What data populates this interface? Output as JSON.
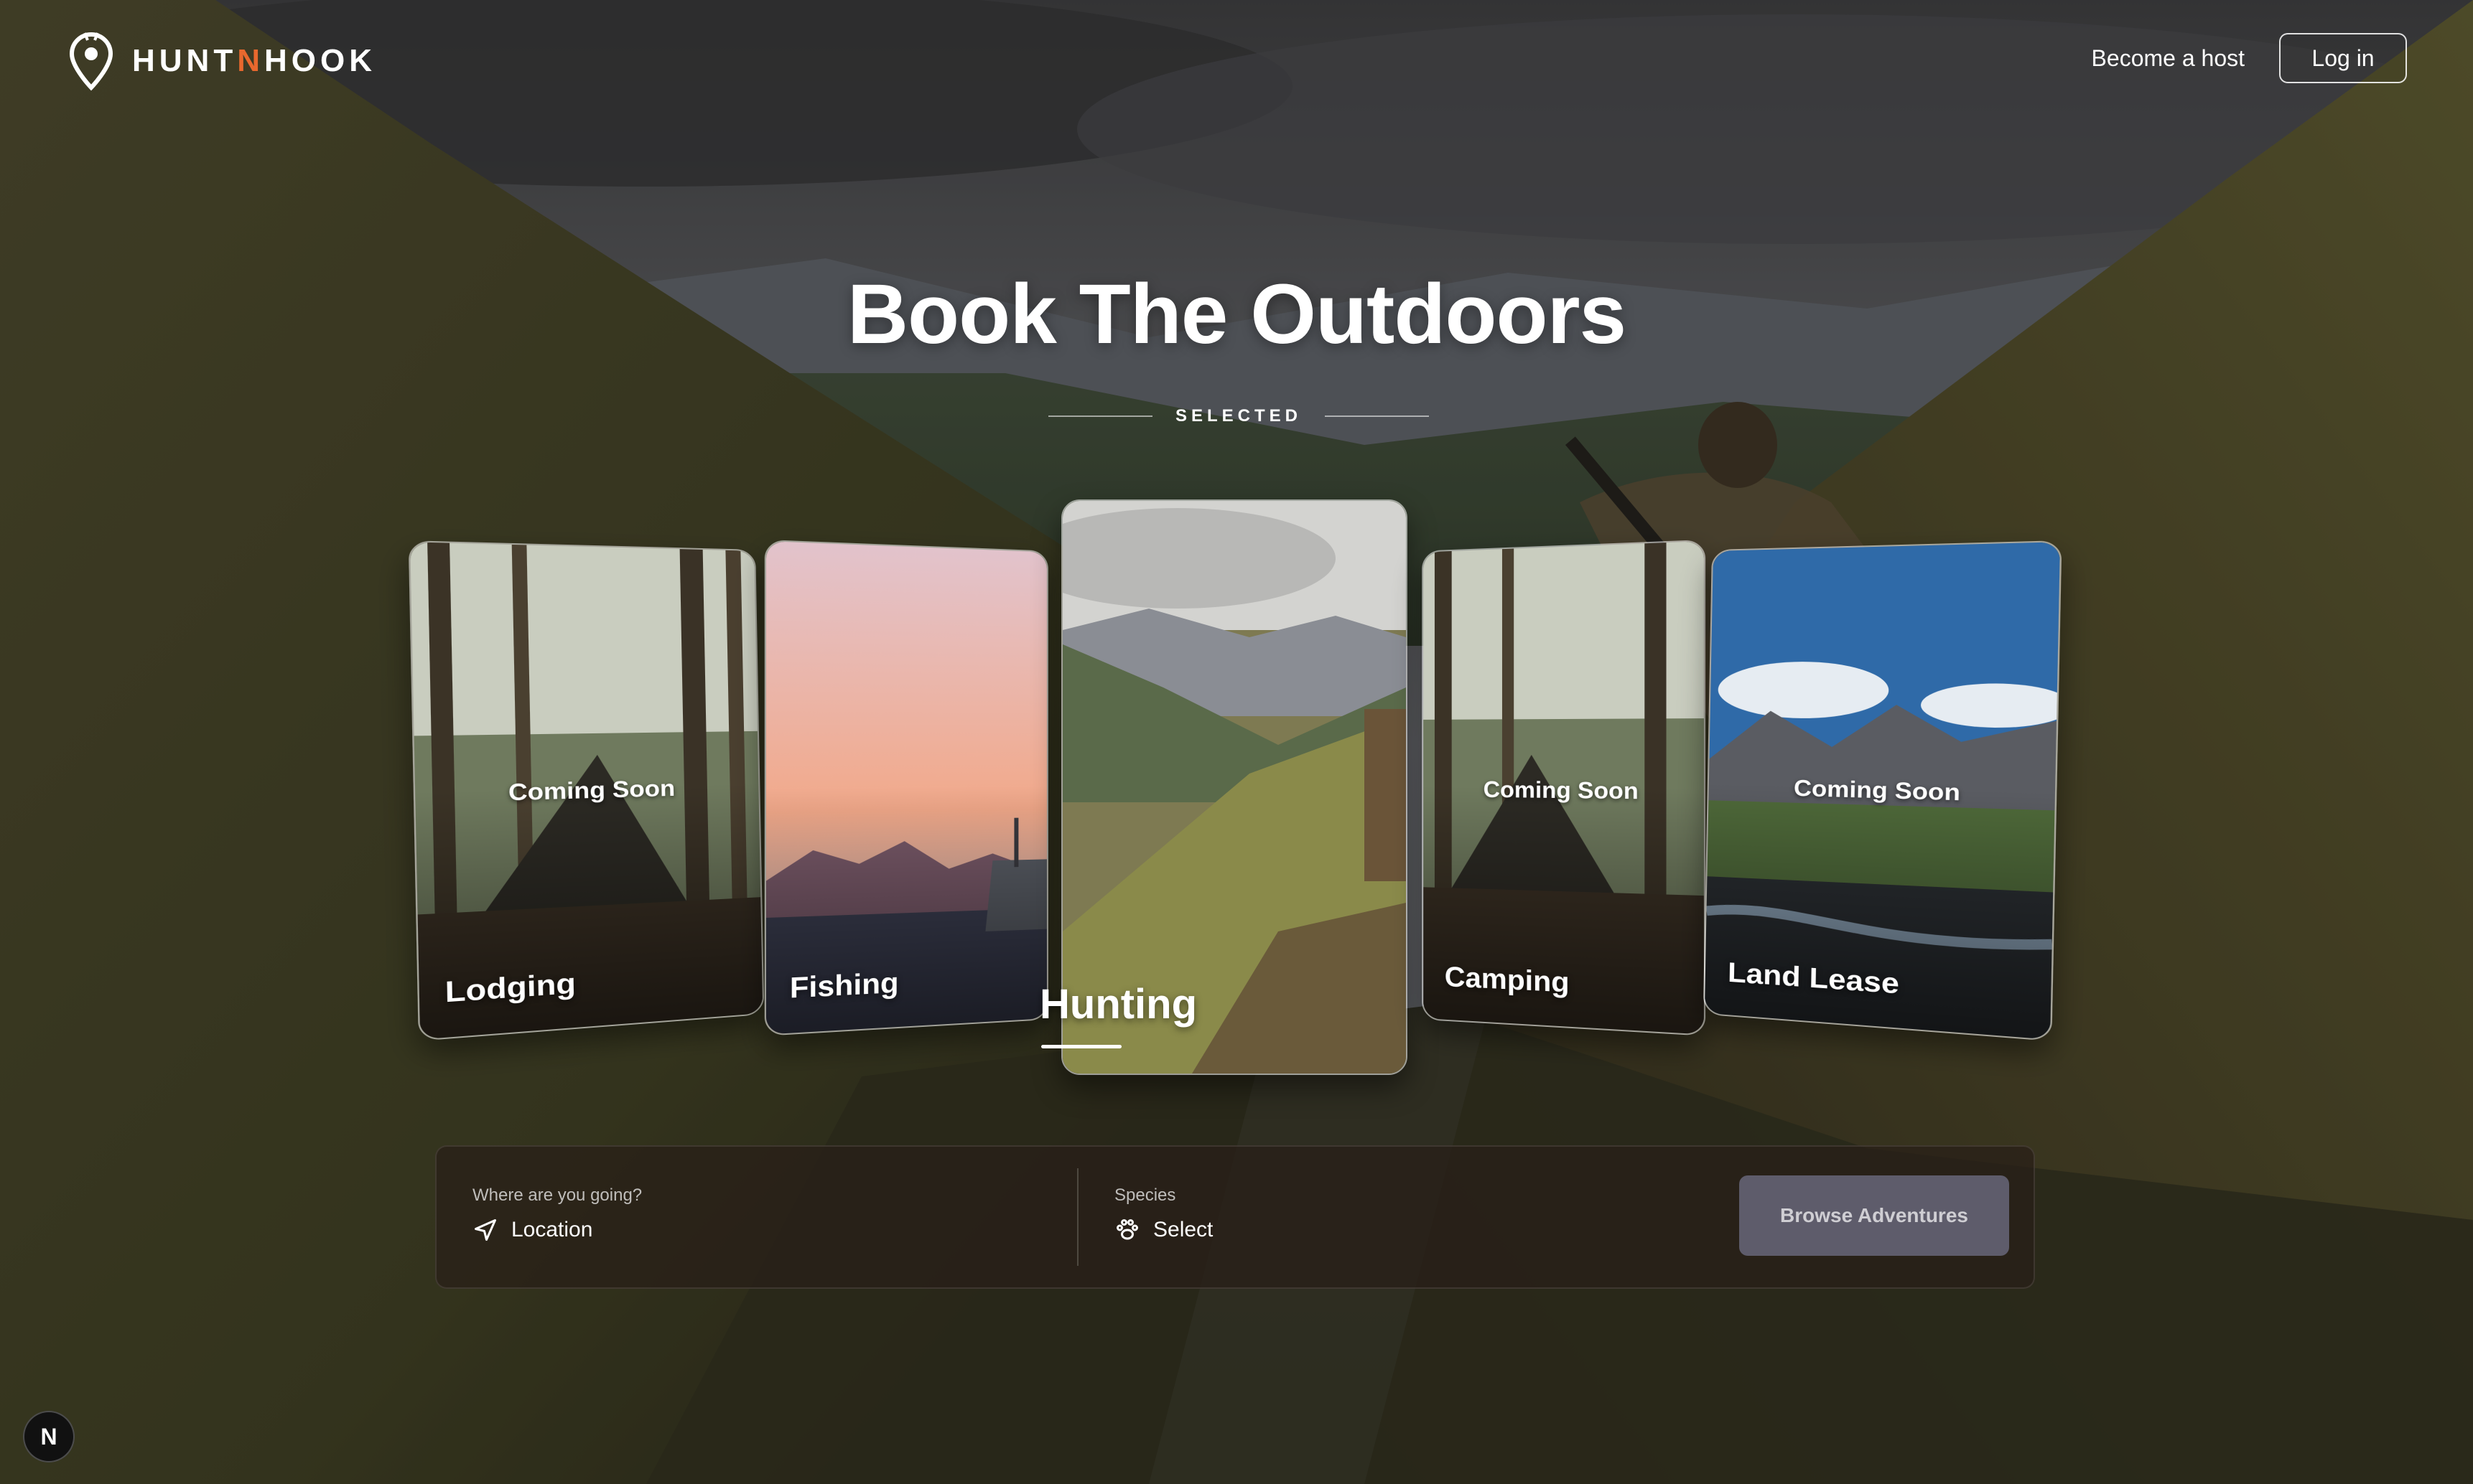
{
  "brand": {
    "name_part1": "HUNT",
    "name_accent": "N",
    "name_part2": "HOOK",
    "accent_color": "#e8682e",
    "icon": "map-pin-logo-icon"
  },
  "nav": {
    "become_host": "Become a host",
    "login": "Log in"
  },
  "hero": {
    "title": "Book The Outdoors",
    "selected_label": "SELECTED"
  },
  "categories": [
    {
      "label": "Lodging",
      "badge": "Coming Soon",
      "selected": false
    },
    {
      "label": "Fishing",
      "badge": "",
      "selected": false
    },
    {
      "label": "Hunting",
      "badge": "",
      "selected": true
    },
    {
      "label": "Camping",
      "badge": "Coming Soon",
      "selected": false
    },
    {
      "label": "Land Lease",
      "badge": "Coming Soon",
      "selected": false
    }
  ],
  "search": {
    "location": {
      "label": "Where are you going?",
      "value": "Location",
      "icon": "navigation-arrow-icon"
    },
    "species": {
      "label": "Species",
      "value": "Select",
      "icon": "paw-icon"
    },
    "button": "Browse Adventures"
  },
  "corner_badge": "N"
}
